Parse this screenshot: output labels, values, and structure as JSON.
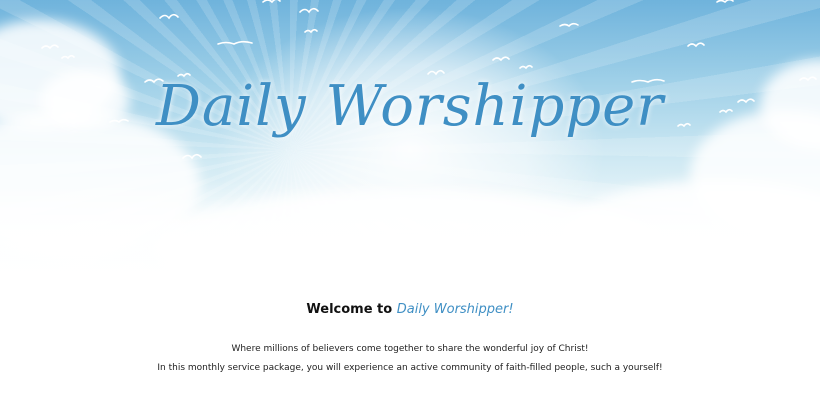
{
  "hero": {
    "logo_text": "Daily Worshipper"
  },
  "welcome": {
    "prefix": "Welcome to ",
    "brand": "Daily Worshipper!"
  },
  "intro": {
    "line1": "Where millions of believers come together to share the wonderful joy of Christ!",
    "line2": "In this monthly service package, you will experience an active community of faith-filled people, such a yourself!"
  },
  "colors": {
    "brand_blue": "#3f8fc4",
    "sky_top": "#6fb3dc",
    "text_dark": "#111111"
  },
  "icons": [
    "bird-icon"
  ]
}
